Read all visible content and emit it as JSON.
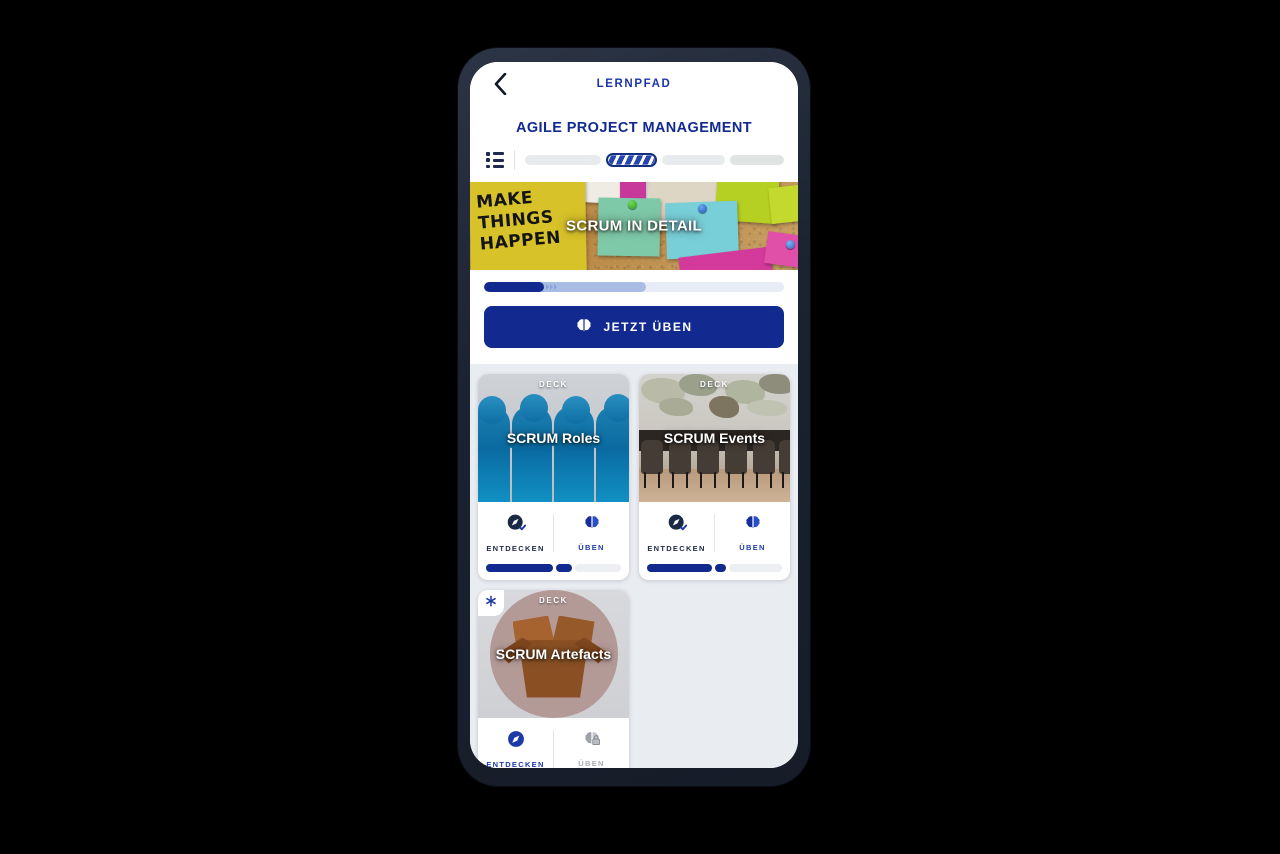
{
  "app": {
    "header": {
      "back_icon": "chevron-left-icon",
      "title": "LERNPFAD",
      "course_title": "AGILE PROJECT MANAGEMENT"
    },
    "segment_bar": {
      "list_icon": "list-icon",
      "segments": [
        {
          "state": "done",
          "label": ""
        },
        {
          "state": "active",
          "label": ""
        },
        {
          "state": "done",
          "label": ""
        },
        {
          "state": "todo",
          "label": ""
        }
      ]
    },
    "hero": {
      "label": "SCRUM IN DETAIL",
      "sticky_note_text": "MAKE THINGS HAPPEN"
    },
    "lesson": {
      "progress_percent": 20,
      "progress_mid_percent": 54,
      "cta_label": "JETZT ÜBEN",
      "cta_icon": "brain-icon",
      "cta_color": "#122a8f"
    },
    "decks": [
      {
        "badge": "DECK",
        "title": "SCRUM Roles",
        "artwork": "puzzle-people-blue",
        "new_badge": false,
        "new_badge_icon": "",
        "actions": [
          {
            "icon": "compass-check-icon",
            "label": "ENTDECKEN",
            "state": "enabled"
          },
          {
            "icon": "brain-icon",
            "label": "ÜBEN",
            "state": "blue"
          }
        ],
        "progress": [
          {
            "width_percent": 52
          },
          {
            "width_percent": 12
          }
        ]
      },
      {
        "badge": "DECK",
        "title": "SCRUM Events",
        "artwork": "meeting-room",
        "new_badge": false,
        "new_badge_icon": "",
        "actions": [
          {
            "icon": "compass-check-icon",
            "label": "ENTDECKEN",
            "state": "enabled"
          },
          {
            "icon": "brain-icon",
            "label": "ÜBEN",
            "state": "blue"
          }
        ],
        "progress": [
          {
            "width_percent": 50
          },
          {
            "width_percent": 9
          }
        ]
      },
      {
        "badge": "DECK",
        "title": "SCRUM Artefacts",
        "artwork": "open-cardboard-box",
        "new_badge": true,
        "new_badge_icon": "asterisk-new-icon",
        "actions": [
          {
            "icon": "compass-icon",
            "label": "ENTDECKEN",
            "state": "blue"
          },
          {
            "icon": "brain-lock-icon",
            "label": "ÜBEN",
            "state": "locked"
          }
        ],
        "progress": []
      }
    ],
    "colors": {
      "brand_blue": "#122a8f",
      "accent_blue": "#1e3aa8",
      "bezel": "#1b2230",
      "surface": "#e9ecf0"
    }
  }
}
